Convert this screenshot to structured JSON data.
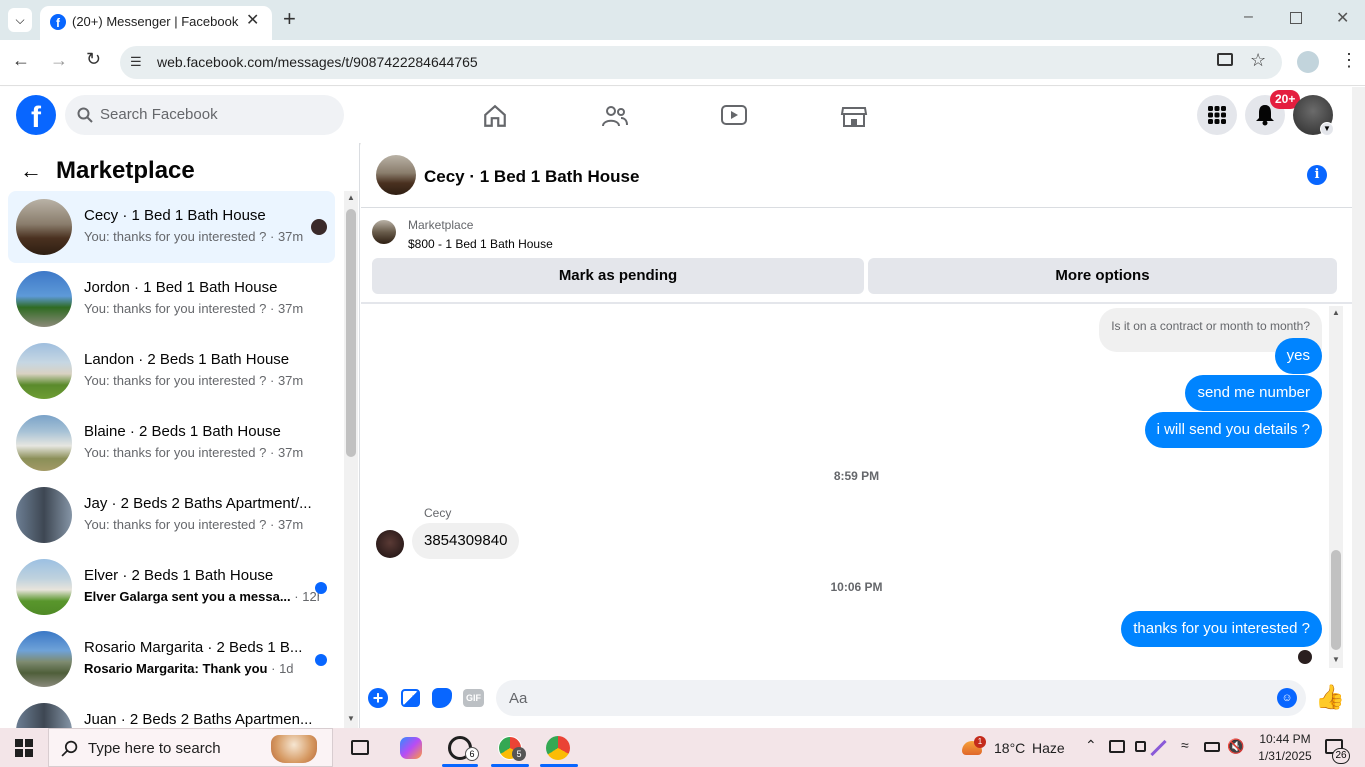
{
  "browser": {
    "tab_title": "(20+) Messenger | Facebook",
    "url": "web.facebook.com/messages/t/9087422284644765"
  },
  "fb": {
    "search_placeholder": "Search Facebook",
    "notif_badge": "20+",
    "accent": "#0866ff"
  },
  "left": {
    "heading": "Marketplace",
    "conversations": [
      {
        "title": "Cecy · 1 Bed 1 Bath House",
        "preview": "You: thanks for you interested ?",
        "time": "37m",
        "unread": false,
        "active": true
      },
      {
        "title": "Jordon · 1 Bed 1 Bath House",
        "preview": "You: thanks for you interested ?",
        "time": "37m",
        "unread": false,
        "active": false
      },
      {
        "title": "Landon · 2 Beds 1 Bath House",
        "preview": "You: thanks for you interested ?",
        "time": "37m",
        "unread": false,
        "active": false
      },
      {
        "title": "Blaine · 2 Beds 1 Bath House",
        "preview": "You: thanks for you interested ?",
        "time": "37m",
        "unread": false,
        "active": false
      },
      {
        "title": "Jay · 2 Beds 2 Baths Apartment/...",
        "preview": "You: thanks for you interested ?",
        "time": "37m",
        "unread": false,
        "active": false
      },
      {
        "title": "Elver · 2 Beds 1 Bath House",
        "preview": "Elver Galarga sent you a messa...",
        "time": "12h",
        "unread": true,
        "active": false
      },
      {
        "title": "Rosario Margarita · 2 Beds 1 B...",
        "preview": "Rosario Margarita: Thank you",
        "time": "1d",
        "unread": true,
        "active": false
      },
      {
        "title": "Juan · 2 Beds 2 Baths Apartmen...",
        "preview": "",
        "time": "",
        "unread": false,
        "active": false
      }
    ]
  },
  "chat": {
    "title": "Cecy · 1 Bed 1 Bath House",
    "listing_label": "Marketplace",
    "listing_detail": "$800 - 1 Bed 1 Bath House",
    "mark_pending": "Mark as pending",
    "more_options": "More options",
    "messages": {
      "in1": "Is it on a contract or month to month?",
      "out1": "yes",
      "out2": "send me number",
      "out3": "i will send you details ?",
      "time1": "8:59 PM",
      "sender": "Cecy",
      "in2": "3854309840",
      "time2": "10:06 PM",
      "out4": "thanks for you interested ?"
    },
    "composer_placeholder": "Aa",
    "gif_label": "GIF"
  },
  "taskbar": {
    "search_placeholder": "Type here to search",
    "weather_temp": "18°C",
    "weather_desc": "Haze",
    "time": "10:44 PM",
    "date": "1/31/2025",
    "notif_count": "26",
    "whatsapp_badge": "6",
    "chrome_badge": "5",
    "weather_badge": "1"
  }
}
